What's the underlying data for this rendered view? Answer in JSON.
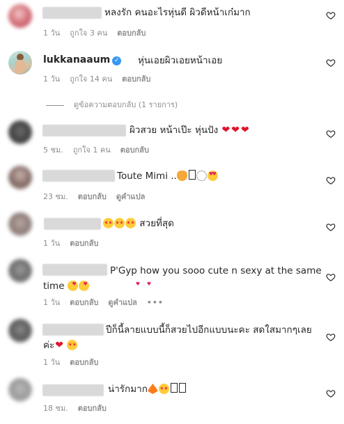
{
  "comments": [
    {
      "text": "หลงรัก คนอะไรหุ่นดี ผิวดีหน้าเก๋มาก",
      "time": "1 วัน",
      "likes": "ถูกใจ 3 คน",
      "reply": "ตอบกลับ"
    },
    {
      "username": "lukkanaaum",
      "verified_icon": "verified-badge-icon",
      "text": "หุ่นเอยผิวเอยหน้าเอย",
      "time": "1 วัน",
      "likes": "ถูกใจ 14 คน",
      "reply": "ตอบกลับ",
      "view_replies": "ดูข้อความตอบกลับ (1 รายการ)"
    },
    {
      "text": "ผิวสวย หน้าเป๊ะ หุ่นปัง",
      "time": "5 ชม.",
      "likes": "ถูกใจ 1 คน",
      "reply": "ตอบกลับ"
    },
    {
      "text": "Toute Mimi ..",
      "time": "23 ชม.",
      "reply": "ตอบกลับ",
      "translate": "ดูคำแปล"
    },
    {
      "text": "สวยที่สุด",
      "time": "1 วัน",
      "reply": "ตอบกลับ"
    },
    {
      "text": "P'Gyp how you sooo cute n sexy at the same time",
      "time": "1 วัน",
      "reply": "ตอบกลับ",
      "translate": "ดูคำแปล",
      "more": "•••"
    },
    {
      "text": "ปีก็นี้ลายแบบนี้ก็สวยไปอีกแบบนะคะ สดใสมากๆเลยค่ะ",
      "time": "1 วัน",
      "reply": "ตอบกลับ"
    },
    {
      "text": "น่ารักมาก",
      "time": "18 ชม.",
      "reply": "ตอบกลับ"
    }
  ],
  "colors": {
    "text": "#262626",
    "meta": "#8e8e8e",
    "verified": "#3897f0",
    "heart_emoji": "#e0142b"
  },
  "icons": {
    "like": "heart-outline-icon"
  }
}
